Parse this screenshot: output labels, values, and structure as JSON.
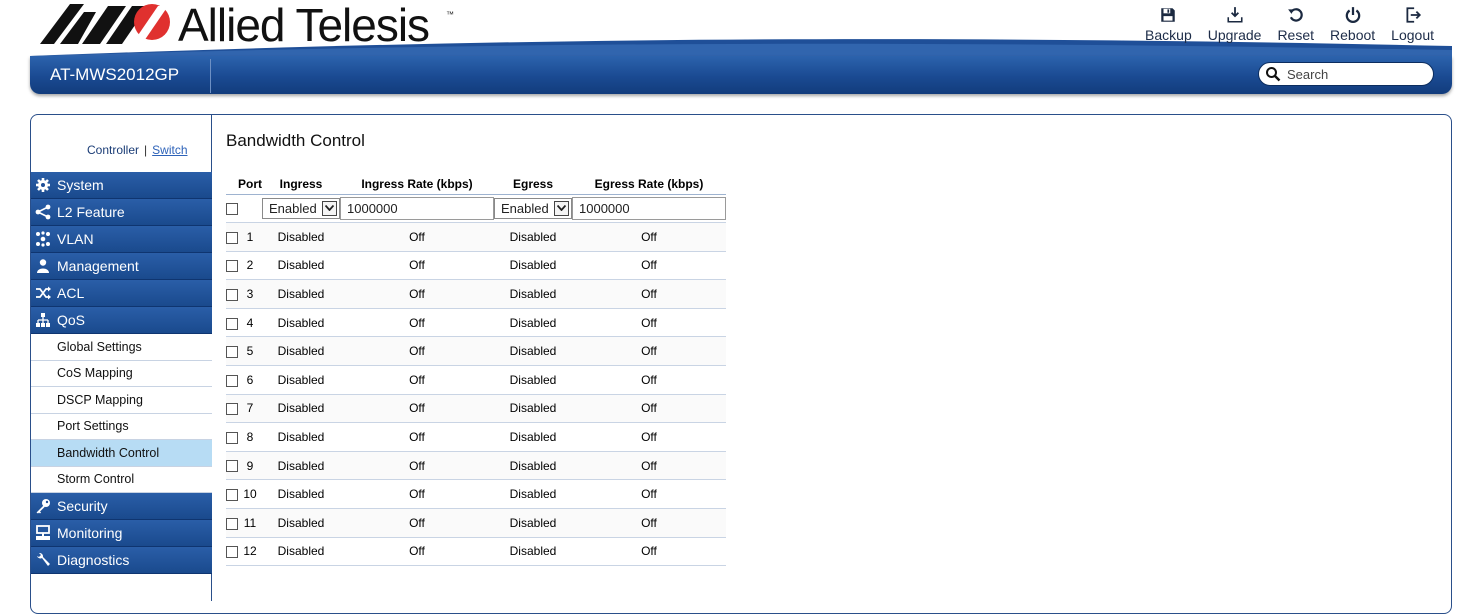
{
  "brand": {
    "name": "Allied Telesis",
    "trademark": "™",
    "model": "AT-MWS2012GP"
  },
  "top_actions": [
    {
      "label": "Backup",
      "icon": "save-icon"
    },
    {
      "label": "Upgrade",
      "icon": "download-icon"
    },
    {
      "label": "Reset",
      "icon": "reset-icon"
    },
    {
      "label": "Reboot",
      "icon": "power-icon"
    },
    {
      "label": "Logout",
      "icon": "logout-icon"
    }
  ],
  "search": {
    "placeholder": "Search"
  },
  "context": {
    "controller": "Controller",
    "separator": "|",
    "switch": "Switch"
  },
  "sidebar": {
    "items": [
      {
        "label": "System",
        "icon": "gear-icon"
      },
      {
        "label": "L2 Feature",
        "icon": "share-icon"
      },
      {
        "label": "VLAN",
        "icon": "cluster-icon"
      },
      {
        "label": "Management",
        "icon": "user-icon"
      },
      {
        "label": "ACL",
        "icon": "shuffle-icon"
      },
      {
        "label": "QoS",
        "icon": "sitemap-icon"
      },
      {
        "label": "Security",
        "icon": "key-icon"
      },
      {
        "label": "Monitoring",
        "icon": "monitor-icon"
      },
      {
        "label": "Diagnostics",
        "icon": "wrench-icon"
      }
    ],
    "qos_subitems": [
      {
        "label": "Global Settings"
      },
      {
        "label": "CoS Mapping"
      },
      {
        "label": "DSCP Mapping"
      },
      {
        "label": "Port Settings"
      },
      {
        "label": "Bandwidth Control"
      },
      {
        "label": "Storm Control"
      }
    ],
    "selected": "Bandwidth Control"
  },
  "page": {
    "title": "Bandwidth Control",
    "columns": [
      "Port",
      "Ingress",
      "Ingress Rate (kbps)",
      "Egress",
      "Egress Rate (kbps)"
    ],
    "edit_row": {
      "ingress": "Enabled",
      "ingress_rate": "1000000",
      "egress": "Enabled",
      "egress_rate": "1000000"
    },
    "rows": [
      {
        "port": "1",
        "ingress": "Disabled",
        "ingress_rate": "Off",
        "egress": "Disabled",
        "egress_rate": "Off"
      },
      {
        "port": "2",
        "ingress": "Disabled",
        "ingress_rate": "Off",
        "egress": "Disabled",
        "egress_rate": "Off"
      },
      {
        "port": "3",
        "ingress": "Disabled",
        "ingress_rate": "Off",
        "egress": "Disabled",
        "egress_rate": "Off"
      },
      {
        "port": "4",
        "ingress": "Disabled",
        "ingress_rate": "Off",
        "egress": "Disabled",
        "egress_rate": "Off"
      },
      {
        "port": "5",
        "ingress": "Disabled",
        "ingress_rate": "Off",
        "egress": "Disabled",
        "egress_rate": "Off"
      },
      {
        "port": "6",
        "ingress": "Disabled",
        "ingress_rate": "Off",
        "egress": "Disabled",
        "egress_rate": "Off"
      },
      {
        "port": "7",
        "ingress": "Disabled",
        "ingress_rate": "Off",
        "egress": "Disabled",
        "egress_rate": "Off"
      },
      {
        "port": "8",
        "ingress": "Disabled",
        "ingress_rate": "Off",
        "egress": "Disabled",
        "egress_rate": "Off"
      },
      {
        "port": "9",
        "ingress": "Disabled",
        "ingress_rate": "Off",
        "egress": "Disabled",
        "egress_rate": "Off"
      },
      {
        "port": "10",
        "ingress": "Disabled",
        "ingress_rate": "Off",
        "egress": "Disabled",
        "egress_rate": "Off"
      },
      {
        "port": "11",
        "ingress": "Disabled",
        "ingress_rate": "Off",
        "egress": "Disabled",
        "egress_rate": "Off"
      },
      {
        "port": "12",
        "ingress": "Disabled",
        "ingress_rate": "Off",
        "egress": "Disabled",
        "egress_rate": "Off"
      }
    ]
  },
  "colors": {
    "nav_blue": "#1a4a92",
    "selected_row": "#b7dcf4",
    "logo_red": "#e0312f"
  }
}
